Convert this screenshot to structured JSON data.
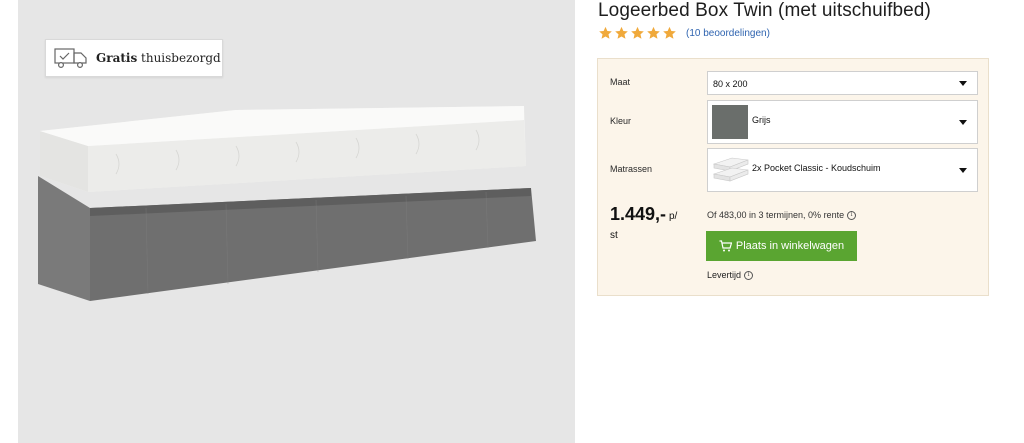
{
  "product": {
    "title": "Logeerbed Box Twin (met uitschuifbed)",
    "rating_stars": 5,
    "rating_color": "#f0a93b",
    "reviews_text": "(10 beoordelingen)"
  },
  "badge": {
    "bold": "Gratis",
    "rest": " thuisbezorgd",
    "icon": "delivery-truck-icon"
  },
  "options": {
    "size": {
      "label": "Maat",
      "value": "80 x 200"
    },
    "color": {
      "label": "Kleur",
      "value": "Grijs",
      "swatch": "#6a6e6b"
    },
    "mattress": {
      "label": "Matrassen",
      "value": "2x Pocket Classic - Koudschuim"
    }
  },
  "price": {
    "amount": "1.449,-",
    "unit_a": "p/",
    "unit_b": "st",
    "installments": "Of 483,00 in 3 termijnen, 0% rente"
  },
  "cart": {
    "label": "Plaats in winkelwagen",
    "color": "#5aa531"
  },
  "delivery_time": {
    "label": "Levertijd"
  },
  "colors": {
    "panel_bg": "#fcf5ea",
    "image_bg": "#e6e6e6",
    "link": "#2f64b0"
  }
}
